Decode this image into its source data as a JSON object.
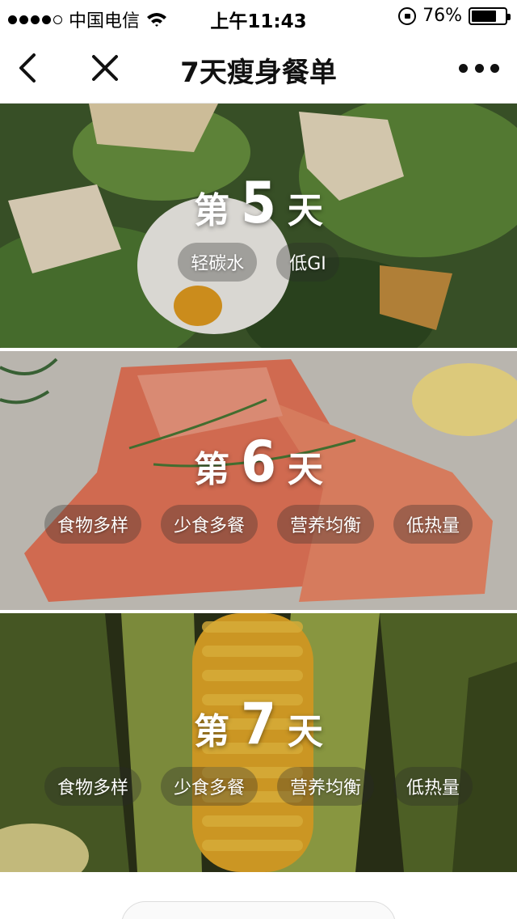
{
  "status_bar": {
    "carrier": "中国电信",
    "time": "上午11:43",
    "battery_percent": "76%",
    "battery_level": 0.76,
    "signal_icon": "signal-dots-icon",
    "wifi_icon": "wifi-icon",
    "rotation_lock_icon": "rotation-lock-icon",
    "battery_icon": "battery-icon"
  },
  "nav": {
    "title": "7天瘦身餐单",
    "back_icon": "chevron-left-icon",
    "close_icon": "close-icon",
    "more_icon": "more-dots-icon"
  },
  "days": [
    {
      "word_left": "第",
      "number": "5",
      "word_right": "天",
      "tags": [
        "轻碳水",
        "低GI"
      ],
      "image": "salad-photo"
    },
    {
      "word_left": "第",
      "number": "6",
      "word_right": "天",
      "tags": [
        "食物多样",
        "少食多餐",
        "营养均衡",
        "低热量"
      ],
      "image": "salmon-photo"
    },
    {
      "word_left": "第",
      "number": "7",
      "word_right": "天",
      "tags": [
        "食物多样",
        "少食多餐",
        "营养均衡",
        "低热量"
      ],
      "image": "corn-photo"
    }
  ],
  "colors": {
    "text": "#111111",
    "overlay_tag": "rgba(40,40,40,0.32)"
  }
}
